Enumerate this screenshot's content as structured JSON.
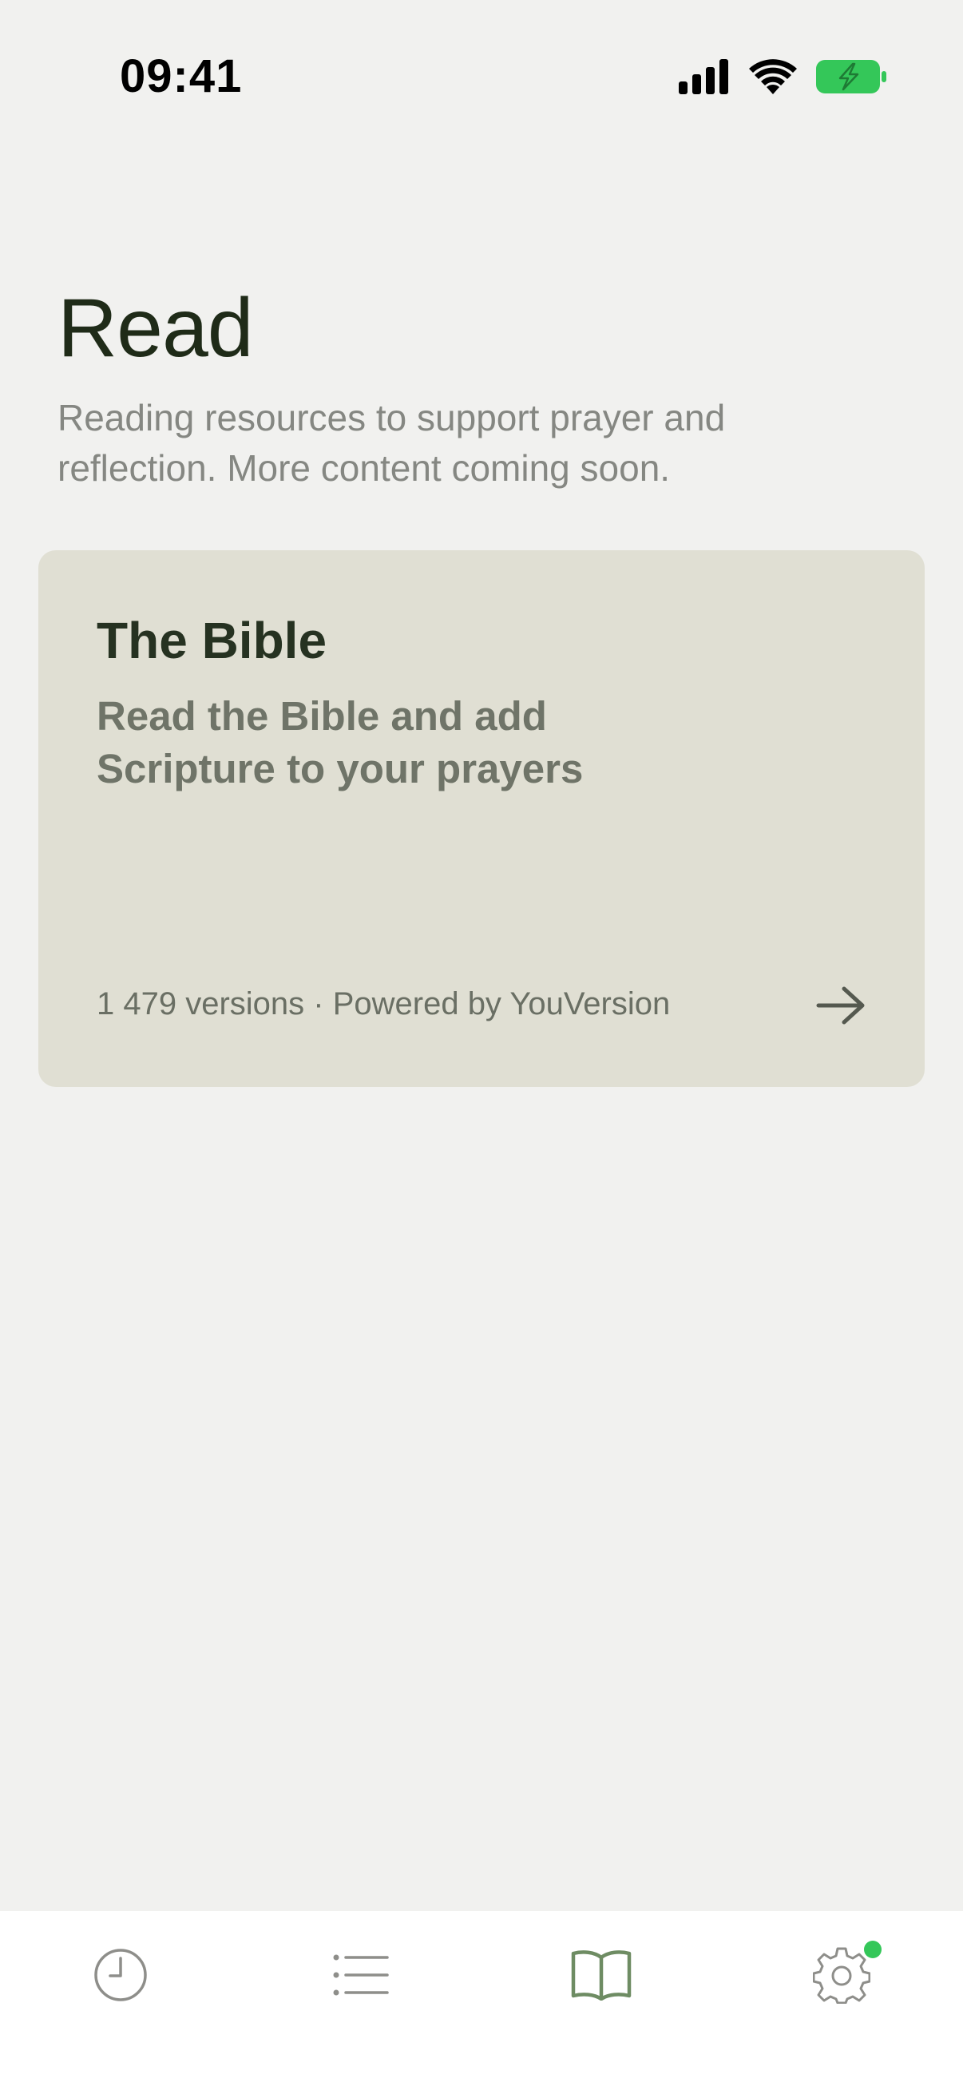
{
  "status_bar": {
    "time": "09:41",
    "battery_color": "#34C759"
  },
  "header": {
    "title": "Read",
    "subtitle": "Reading resources to support prayer and reflection. More content coming soon."
  },
  "bible_card": {
    "title": "The Bible",
    "description": "Read the Bible and add Scripture to your prayers",
    "footer": "1 479 versions · Powered by YouVersion",
    "arrow_icon": "arrow-right-icon",
    "background": "#E0DFD3"
  },
  "tab_bar": {
    "tabs": [
      {
        "icon": "clock-icon",
        "active": false
      },
      {
        "icon": "list-icon",
        "active": false
      },
      {
        "icon": "book-icon",
        "active": true
      },
      {
        "icon": "gear-icon",
        "active": false,
        "badge": true
      }
    ],
    "active_color": "#6E8C63",
    "inactive_color": "#8E8E8A",
    "badge_color": "#34C759"
  }
}
